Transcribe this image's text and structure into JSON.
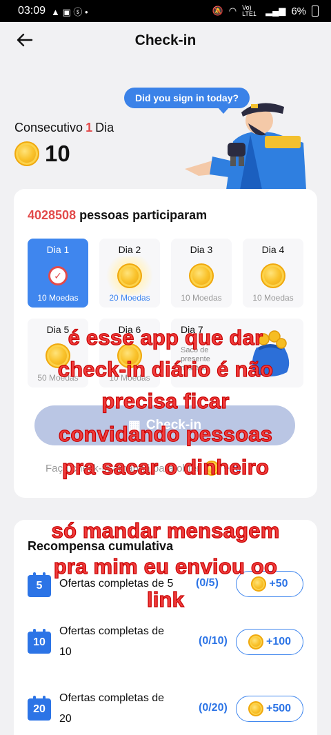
{
  "status_bar": {
    "time": "03:09",
    "battery": "6%",
    "network": "Vo) LTE1"
  },
  "header": {
    "title": "Check-in"
  },
  "hero": {
    "bubble": "Did you sign in today?",
    "consec_prefix": "Consecutivo",
    "consec_value": "1",
    "consec_suffix": "Dia",
    "coins": "10"
  },
  "participants": {
    "count": "4028508",
    "label": "pessoas participaram"
  },
  "days": [
    {
      "label": "Dia 1",
      "reward": "10 Moedas"
    },
    {
      "label": "Dia 2",
      "reward": "20 Moedas"
    },
    {
      "label": "Dia 3",
      "reward": "10 Moedas"
    },
    {
      "label": "Dia 4",
      "reward": "10 Moedas"
    },
    {
      "label": "Dia 5",
      "reward": "50 Moedas"
    },
    {
      "label": "Dia 6",
      "reward": "10 Moedas"
    },
    {
      "label": "Dia 7",
      "reward": "Saco de presente mistério"
    }
  ],
  "checkin_button": "Check-in",
  "tip": {
    "text": "Faça check-in amanhã para obter",
    "bonus": "+20"
  },
  "cumulative": {
    "title": "Recompensa cumulativa",
    "rows": [
      {
        "badge": "5",
        "line1": "Ofertas completas de 5",
        "line2": "",
        "progress": "(0/5)",
        "reward": "+50"
      },
      {
        "badge": "10",
        "line1": "Ofertas completas de",
        "line2": "10",
        "progress": "(0/10)",
        "reward": "+100"
      },
      {
        "badge": "20",
        "line1": "Ofertas completas de",
        "line2": "20",
        "progress": "(0/20)",
        "reward": "+500"
      }
    ]
  },
  "overlay_text": [
    "é esse app que dar",
    "check-in diário é não",
    "precisa ficar",
    "convidando pessoas",
    "pra sacar o dinheiro",
    "só mandar mensagem",
    "pra mim eu enviou oo",
    "link"
  ]
}
